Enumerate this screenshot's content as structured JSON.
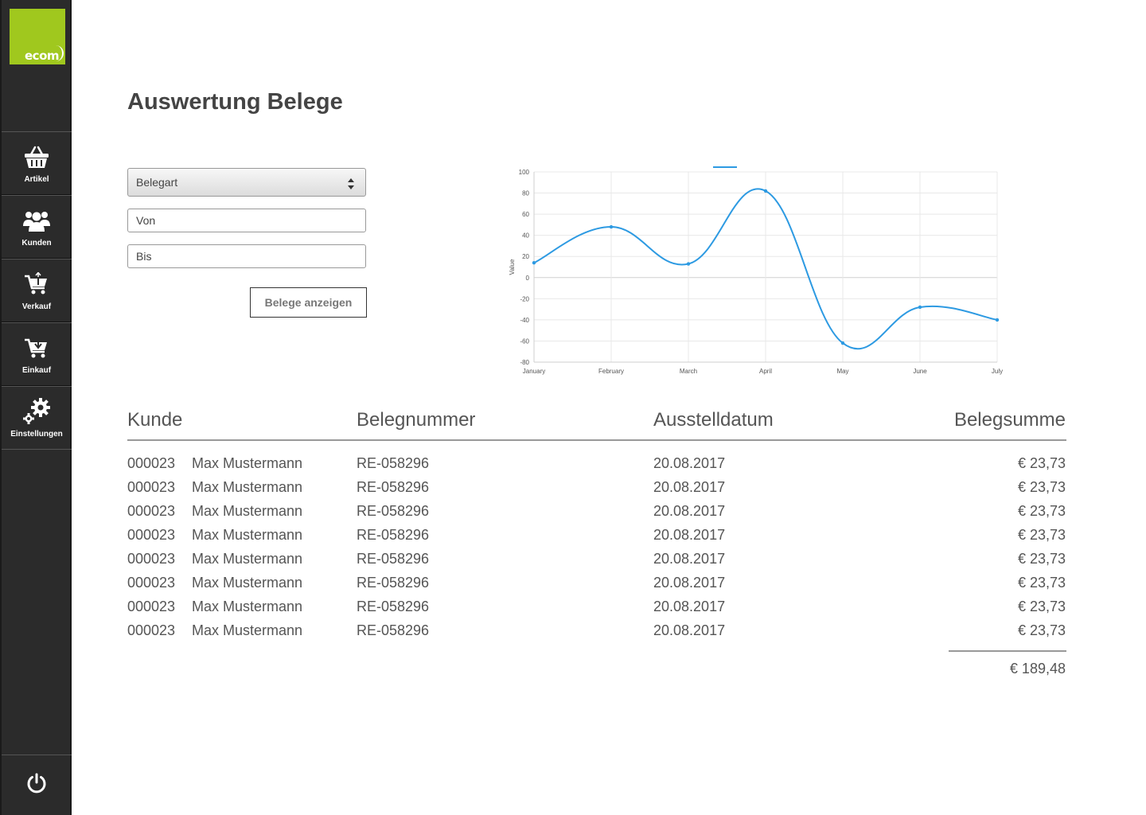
{
  "sidebar": {
    "logo_text": "ecom",
    "items": [
      {
        "label": "Artikel",
        "icon": "basket-icon"
      },
      {
        "label": "Kunden",
        "icon": "users-icon"
      },
      {
        "label": "Verkauf",
        "icon": "cart-out-icon"
      },
      {
        "label": "Einkauf",
        "icon": "cart-in-icon"
      },
      {
        "label": "Einstellungen",
        "icon": "gears-icon"
      }
    ],
    "power_icon": "power-icon"
  },
  "page": {
    "title": "Auswertung Belege"
  },
  "filters": {
    "belegart": "Belegart",
    "von": "Von",
    "bis": "Bis",
    "submit_label": "Belege anzeigen"
  },
  "chart_data": {
    "type": "line",
    "categories": [
      "January",
      "February",
      "March",
      "April",
      "May",
      "June",
      "July"
    ],
    "series": [
      {
        "values": [
          14,
          48,
          13,
          82,
          -62,
          -28,
          -40
        ],
        "color": "#2d9ae2"
      }
    ],
    "ylabel": "Value",
    "xlabel": "",
    "ylim": [
      -80,
      100
    ],
    "yticks": [
      100,
      80,
      60,
      40,
      20,
      0,
      -20,
      -40,
      -60,
      -80
    ],
    "grid": true
  },
  "table": {
    "headers": {
      "kunde": "Kunde",
      "belegnummer": "Belegnummer",
      "datum": "Ausstelldatum",
      "summe": "Belegsumme"
    },
    "rows": [
      {
        "nr": "000023",
        "name": "Max Mustermann",
        "beleg": "RE-058296",
        "datum": "20.08.2017",
        "summe": "€ 23,73"
      },
      {
        "nr": "000023",
        "name": "Max Mustermann",
        "beleg": "RE-058296",
        "datum": "20.08.2017",
        "summe": "€ 23,73"
      },
      {
        "nr": "000023",
        "name": "Max Mustermann",
        "beleg": "RE-058296",
        "datum": "20.08.2017",
        "summe": "€ 23,73"
      },
      {
        "nr": "000023",
        "name": "Max Mustermann",
        "beleg": "RE-058296",
        "datum": "20.08.2017",
        "summe": "€ 23,73"
      },
      {
        "nr": "000023",
        "name": "Max Mustermann",
        "beleg": "RE-058296",
        "datum": "20.08.2017",
        "summe": "€ 23,73"
      },
      {
        "nr": "000023",
        "name": "Max Mustermann",
        "beleg": "RE-058296",
        "datum": "20.08.2017",
        "summe": "€ 23,73"
      },
      {
        "nr": "000023",
        "name": "Max Mustermann",
        "beleg": "RE-058296",
        "datum": "20.08.2017",
        "summe": "€ 23,73"
      },
      {
        "nr": "000023",
        "name": "Max Mustermann",
        "beleg": "RE-058296",
        "datum": "20.08.2017",
        "summe": "€ 23,73"
      }
    ],
    "total": "€ 189,48"
  },
  "colors": {
    "sidebar": "#2b2b2b",
    "logo": "#a0c81e",
    "line": "#2d9ae2"
  }
}
